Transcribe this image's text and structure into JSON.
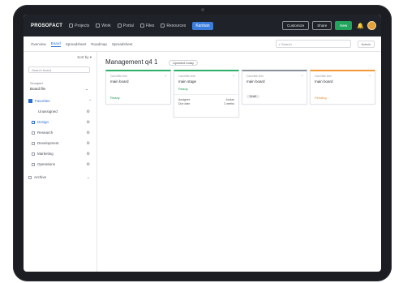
{
  "topnav": {
    "logo": "PROSOFACT",
    "items": [
      {
        "label": "Projects"
      },
      {
        "label": "Work"
      },
      {
        "label": "Portal"
      },
      {
        "label": "Files"
      },
      {
        "label": "Resources"
      }
    ],
    "active_label": "Kanban",
    "btn_outline_1": "Customize",
    "btn_outline_2": "Share",
    "btn_green": "New",
    "bell_icon": "bell-icon",
    "avatar_color": "#e3a23a"
  },
  "tabs": {
    "items": [
      {
        "label": "Overview"
      },
      {
        "label": "Board"
      },
      {
        "label": "Spreadsheet"
      },
      {
        "label": "Roadmap"
      },
      {
        "label": "Spreadsheet"
      }
    ],
    "search_placeholder": "Search",
    "user_chip": "Admin"
  },
  "sidebar": {
    "toggle": "Sort by ▾",
    "search_placeholder": "Search board",
    "label": "Grouped",
    "select_value": "Board file",
    "section_label": "Favorites",
    "rows": [
      {
        "label": "Unassigned"
      },
      {
        "label": "Design"
      },
      {
        "label": "Research"
      },
      {
        "label": "Development"
      },
      {
        "label": "Marketing"
      },
      {
        "label": "Operations"
      }
    ],
    "footer_label": "Archive"
  },
  "main": {
    "title": "Management q4 1",
    "badge": "Updated today",
    "cards": [
      {
        "hdr": "Card title text",
        "title": "main board",
        "status": "Ready",
        "accent": "#2fb06a"
      },
      {
        "hdr": "Card title text",
        "title": "main stage",
        "status": "Ready",
        "meta_1_l": "Assignee",
        "meta_1_r": "Jordan",
        "meta_2_l": "Due date",
        "meta_2_r": "2 weeks",
        "accent": "#2fb06a"
      },
      {
        "hdr": "Card title text",
        "title": "main board",
        "pill": "Draft",
        "accent": "#8c929c"
      },
      {
        "hdr": "Card title text",
        "title": "main board",
        "status": "Pending",
        "accent": "#f39a35"
      }
    ]
  }
}
